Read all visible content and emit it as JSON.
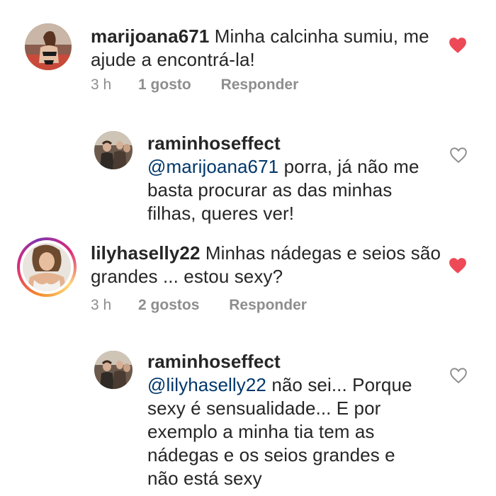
{
  "comments": [
    {
      "username": "marijoana671",
      "text": "Minha calcinha sumiu, me ajude a encontrá-la!",
      "time": "3 h",
      "likes": "1 gosto",
      "reply_label": "Responder",
      "liked": true
    },
    {
      "username": "raminhoseffect",
      "mention": "@marijoana671",
      "text": "porra, já não me basta procurar as das minhas filhas, queres ver!",
      "liked": false
    },
    {
      "username": "lilyhaselly22",
      "text": "Minhas nádegas e seios são grandes ... estou sexy?",
      "time": "3 h",
      "likes": "2 gostos",
      "reply_label": "Responder",
      "liked": true
    },
    {
      "username": "raminhoseffect",
      "mention": "@lilyhaselly22",
      "text": "não sei... Porque sexy é sensualidade... E por exemplo a minha tia tem as nádegas e os seios grandes e não está sexy",
      "liked": false
    }
  ],
  "colors": {
    "liked_heart": "#ed4956",
    "mention": "#00376b",
    "meta": "#8e8e8e"
  }
}
